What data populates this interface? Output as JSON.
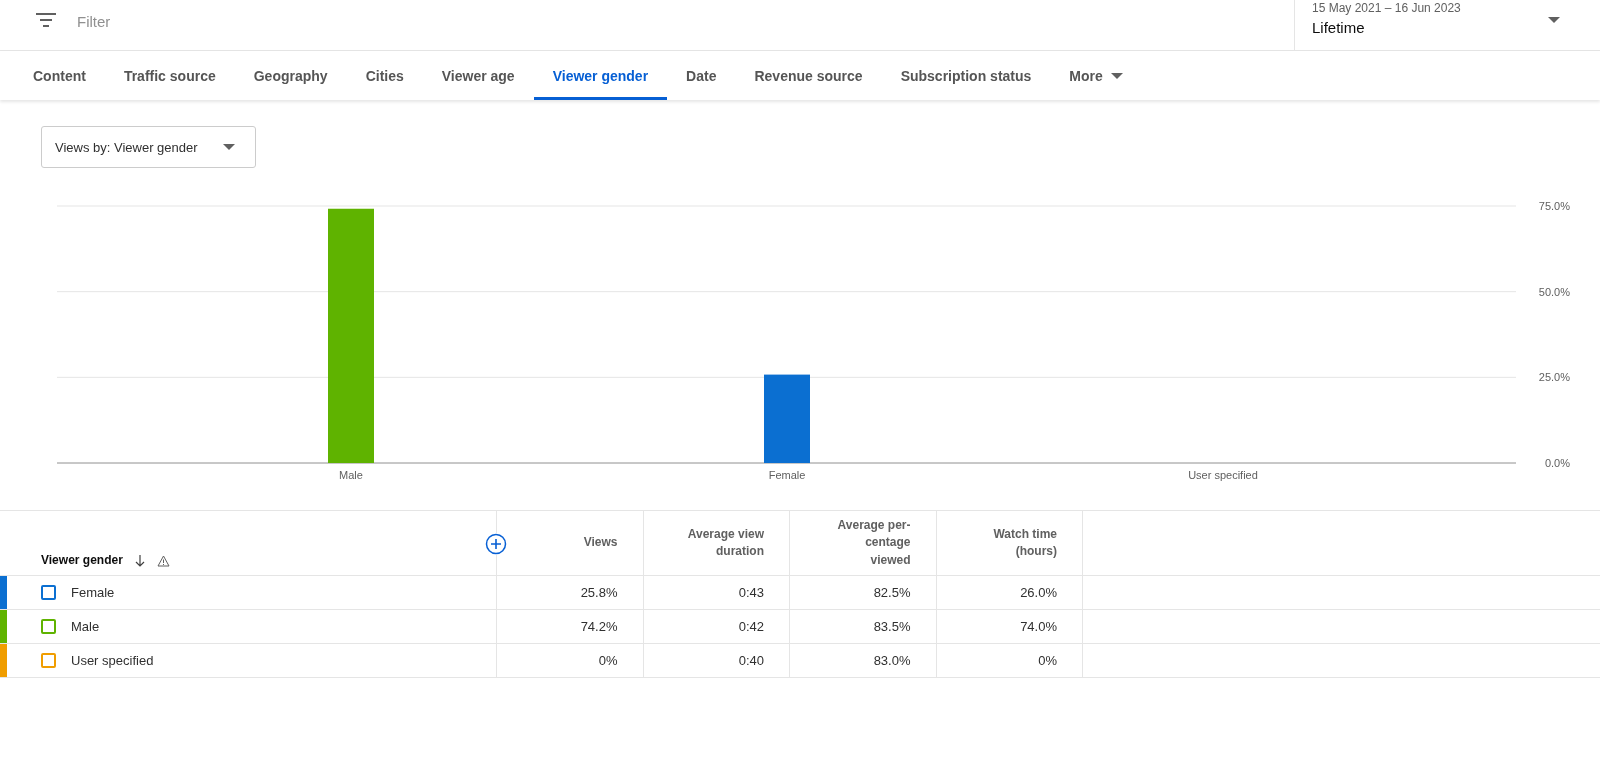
{
  "filter": {
    "placeholder": "Filter"
  },
  "date_range": {
    "range": "15 May 2021 – 16 Jun 2023",
    "label": "Lifetime"
  },
  "tabs": [
    {
      "label": "Content",
      "selected": false
    },
    {
      "label": "Traffic source",
      "selected": false
    },
    {
      "label": "Geography",
      "selected": false
    },
    {
      "label": "Cities",
      "selected": false
    },
    {
      "label": "Viewer age",
      "selected": false
    },
    {
      "label": "Viewer gender",
      "selected": true
    },
    {
      "label": "Date",
      "selected": false
    },
    {
      "label": "Revenue source",
      "selected": false
    },
    {
      "label": "Subscription status",
      "selected": false
    },
    {
      "label": "More",
      "selected": false
    }
  ],
  "views_by": {
    "value": "Views by: Viewer gender"
  },
  "chart": {
    "chart_data": {
      "type": "bar",
      "series": [
        {
          "name": "Male",
          "color": "#5fb300",
          "values": [
            74.2,
            null,
            null
          ]
        },
        {
          "name": "Female",
          "color": "#0b6fd1",
          "values": [
            null,
            25.8,
            null
          ]
        },
        {
          "name": "User specified",
          "values": [
            null,
            null,
            0
          ]
        }
      ],
      "ylim": [
        0,
        75
      ],
      "yticks": [
        {
          "value": 0,
          "label": "0.0%"
        },
        {
          "value": 25,
          "label": "25.0%"
        },
        {
          "value": 50,
          "label": "50.0%"
        },
        {
          "value": 75,
          "label": "75.0%"
        }
      ]
    }
  },
  "table": {
    "columns": [
      "Viewer gender",
      "Views",
      "Average view duration",
      "Average per-centage viewed",
      "Watch time (hours)"
    ],
    "rows": [
      {
        "color": "#0b6fd1",
        "checked": false,
        "cells": [
          "Female",
          "25.8%",
          "0:43",
          "82.5%",
          "26.0%"
        ]
      },
      {
        "color": "#5fb300",
        "checked": false,
        "cells": [
          "Male",
          "74.2%",
          "0:42",
          "83.5%",
          "74.0%"
        ]
      },
      {
        "color": "#f09d00",
        "checked": false,
        "cells": [
          "User specified",
          "0%",
          "0:40",
          "83.0%",
          "0%"
        ]
      }
    ]
  }
}
